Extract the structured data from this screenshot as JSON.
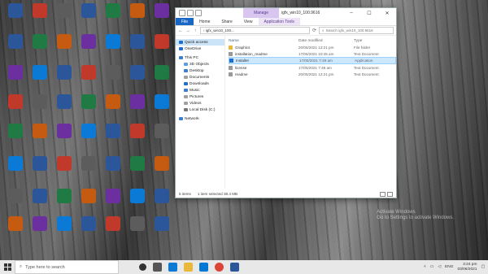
{
  "desktop": {
    "icons": [
      {
        "label": "",
        "color": "#2b579a",
        "glyph": "W"
      },
      {
        "label": "",
        "color": "#c0392b",
        "glyph": "A"
      },
      {
        "label": "",
        "color": "#5c5c5c",
        "glyph": "W"
      },
      {
        "label": "",
        "color": "#2b579a",
        "glyph": "W"
      },
      {
        "label": "",
        "color": "#2b579a",
        "glyph": "W"
      },
      {
        "label": "",
        "color": "#2b579a",
        "glyph": "W"
      },
      {
        "label": "",
        "color": "#2b579a",
        "glyph": "W"
      },
      {
        "label": "",
        "color": "#2b579a",
        "glyph": "W"
      }
    ]
  },
  "explorer": {
    "window_title": "igfx_win10_100.9616",
    "manage_label": "Manage",
    "tabs": [
      "File",
      "Home",
      "Share",
      "View",
      "Application Tools"
    ],
    "nav_back": "←",
    "nav_forward": "→",
    "nav_up": "↑",
    "address": "› igfx_win10_100...",
    "search_placeholder": "Search igfx_win10_100.9616",
    "sidebar": [
      {
        "label": "Quick access",
        "color": "#1f6fd1",
        "selected": true
      },
      {
        "label": "OneDrive",
        "color": "#1f6fd1",
        "selected": false
      },
      {
        "label": "This PC",
        "color": "#3a7fd1",
        "selected": false
      },
      {
        "label": "3D Objects",
        "color": "#5aa0e0",
        "selected": false
      },
      {
        "label": "Desktop",
        "color": "#3a7fd1",
        "selected": false
      },
      {
        "label": "Documents",
        "color": "#a0a0a0",
        "selected": false
      },
      {
        "label": "Downloads",
        "color": "#1f6fd1",
        "selected": false
      },
      {
        "label": "Music",
        "color": "#3a7fd1",
        "selected": false
      },
      {
        "label": "Pictures",
        "color": "#a0a0a0",
        "selected": false
      },
      {
        "label": "Videos",
        "color": "#a0a0a0",
        "selected": false
      },
      {
        "label": "Local Disk (C:)",
        "color": "#777777",
        "selected": false
      },
      {
        "label": "Network",
        "color": "#3a7fd1",
        "selected": false
      }
    ],
    "columns": {
      "name": "Name",
      "date": "Date modified",
      "type": "Type"
    },
    "files": [
      {
        "name": "Graphics",
        "date": "20/05/2021 12:21 pm",
        "type": "File folder",
        "icon": "#e8b939",
        "selected": false
      },
      {
        "name": "installation_readme",
        "date": "17/05/2021 10:45 am",
        "type": "Text Document",
        "icon": "#999999",
        "selected": false
      },
      {
        "name": "Installer",
        "date": "17/05/2021 7:49 am",
        "type": "Application",
        "icon": "#1f6fd1",
        "selected": true
      },
      {
        "name": "license",
        "date": "17/05/2021 7:49 am",
        "type": "Text Document",
        "icon": "#999999",
        "selected": false
      },
      {
        "name": "readme",
        "date": "20/05/2021 12:21 pm",
        "type": "Text Document",
        "icon": "#999999",
        "selected": false
      }
    ],
    "status": {
      "items": "5 items",
      "selection": "1 item selected 38.4 MB"
    }
  },
  "watermark": {
    "line1": "Activate Windows",
    "line2": "Go to Settings to activate Windows."
  },
  "taskbar": {
    "search_placeholder": "Type here to search",
    "lang": "ENG",
    "time": "3:24 pm",
    "date": "03/06/2021"
  }
}
